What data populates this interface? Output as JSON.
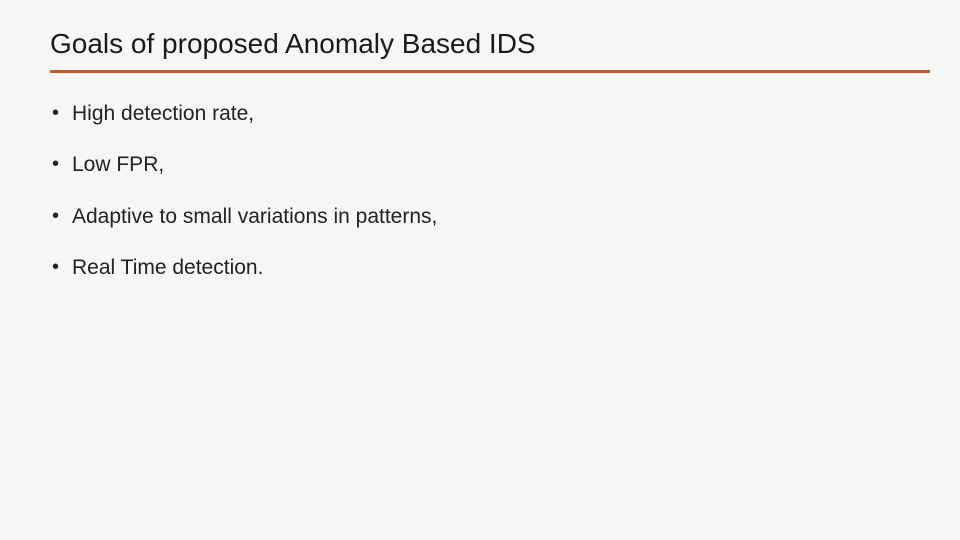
{
  "slide": {
    "title": "Goals of proposed Anomaly Based IDS",
    "bullets": [
      "High detection rate,",
      "Low FPR,",
      "Adaptive to small variations in patterns,",
      "Real Time detection."
    ]
  },
  "colors": {
    "accent_rule": "#c55a2b",
    "background": "#f6f6f4"
  }
}
